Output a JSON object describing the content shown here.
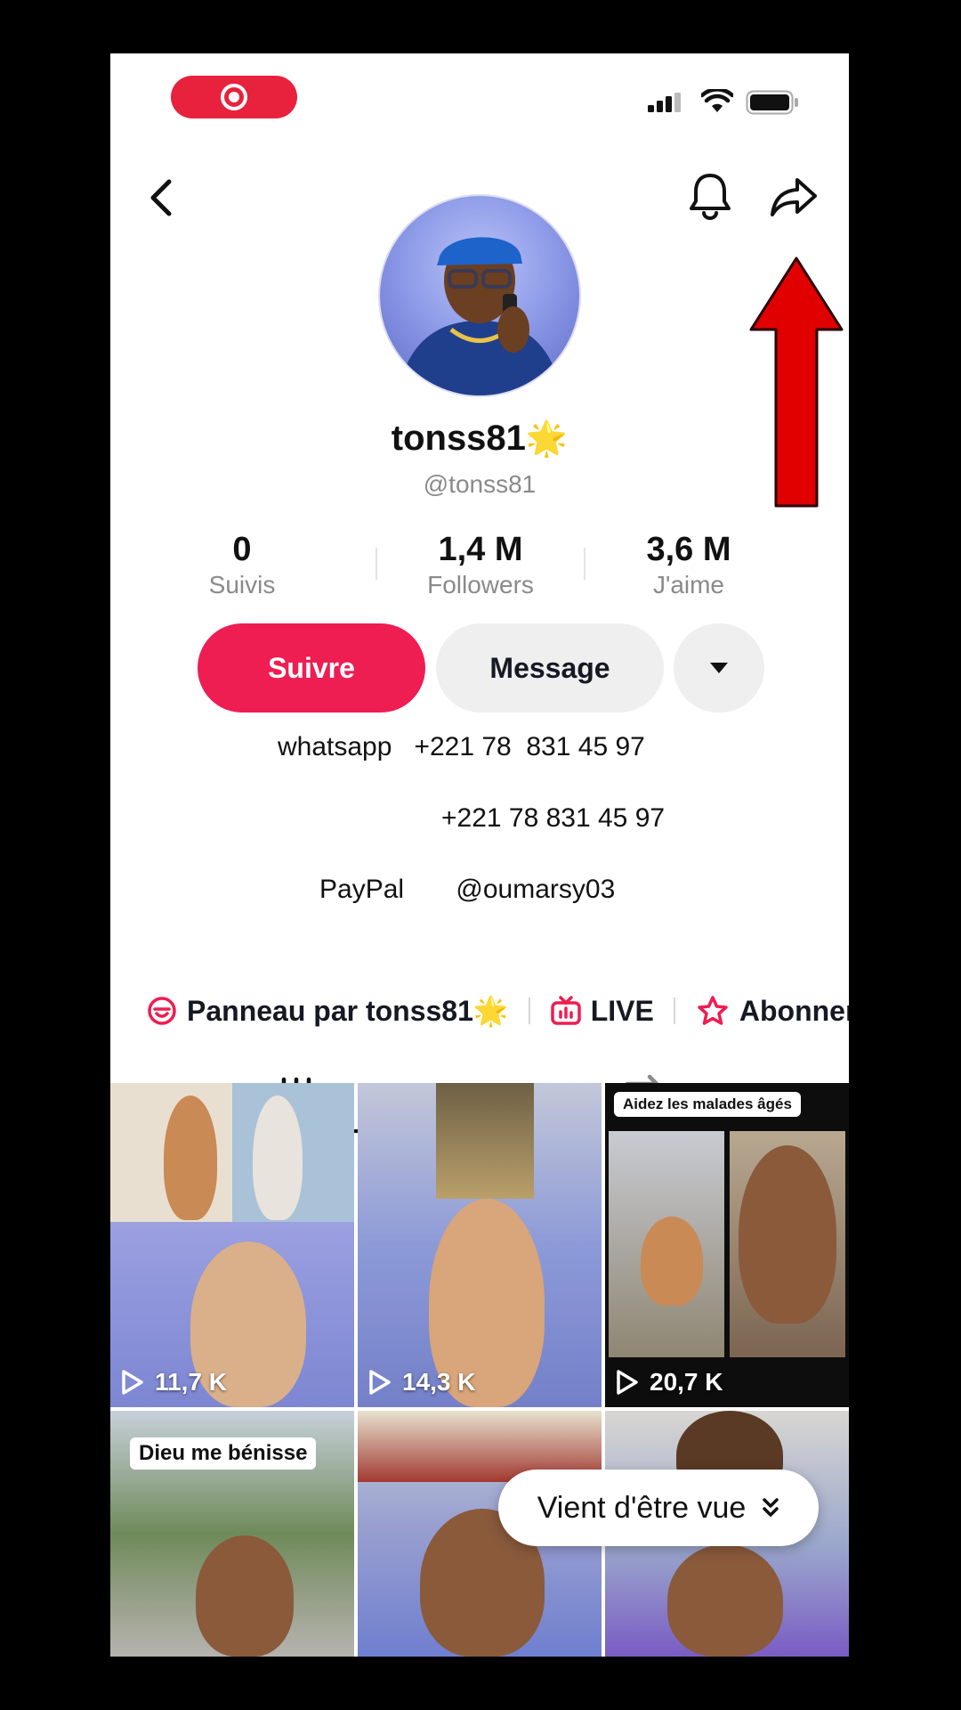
{
  "status_bar": {
    "record_icon": "screen-record-icon",
    "signal_icon": "cellular-signal-icon",
    "wifi_icon": "wifi-icon",
    "battery_icon": "battery-icon"
  },
  "nav": {
    "back_icon": "chevron-left-icon",
    "notification_icon": "bell-icon",
    "share_icon": "share-arrow-icon"
  },
  "profile": {
    "display_name": "tonss81",
    "name_badge": "🌟",
    "username": "@tonss81"
  },
  "stats": [
    {
      "value": "0",
      "label": "Suivis"
    },
    {
      "value": "1,4 M",
      "label": "Followers"
    },
    {
      "value": "3,6 M",
      "label": "J'aime"
    }
  ],
  "actions": {
    "follow_label": "Suivre",
    "message_label": "Message",
    "more_icon": "caret-down-icon"
  },
  "bio": {
    "line1": "whatsapp   +221 78  831 45 97",
    "line2": "+221 78 831 45 97",
    "line3": "PayPal       @oumarsy03"
  },
  "links": {
    "panel_label": "Panneau par tonss81",
    "panel_badge": "🌟",
    "live_label": "LIVE",
    "subscribe_label": "Abonnem"
  },
  "tabs": {
    "videos_icon": "video-grid-icon",
    "repost_icon": "repost-icon"
  },
  "videos": [
    {
      "views": "11,7 K",
      "caption": ""
    },
    {
      "views": "14,3 K",
      "caption": ""
    },
    {
      "views": "20,7 K",
      "caption": "Aidez les malades âgés"
    },
    {
      "views": "",
      "caption": "Dieu me bénisse"
    },
    {
      "views": "",
      "caption": ""
    },
    {
      "views": "",
      "caption": ""
    }
  ],
  "recent_pill": {
    "label": "Vient d'être vue"
  },
  "colors": {
    "follow_button": "#ee1d52",
    "record_pill": "#e8213c",
    "annotation_arrow": "#e00000"
  }
}
